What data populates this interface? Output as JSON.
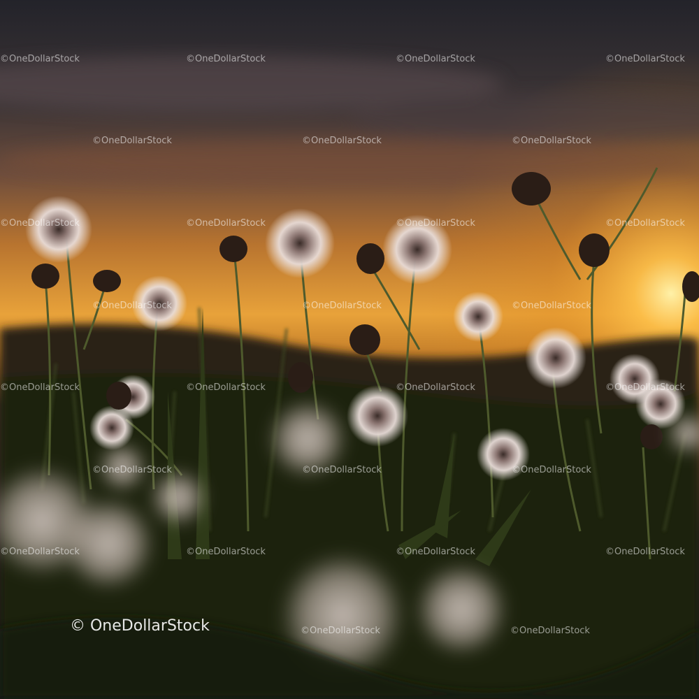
{
  "watermark": {
    "small_text": "©OneDollarStock",
    "large_text": "© OneDollarStock"
  },
  "colors": {
    "sky_top": "#2a2a30",
    "sky_mid": "#6a4a38",
    "horizon_glow": "#f0a93a",
    "sun": "#ffd26a",
    "ground_dark": "#141a10",
    "grass": "#3c4a22",
    "seed_head": "#efe3dc"
  }
}
